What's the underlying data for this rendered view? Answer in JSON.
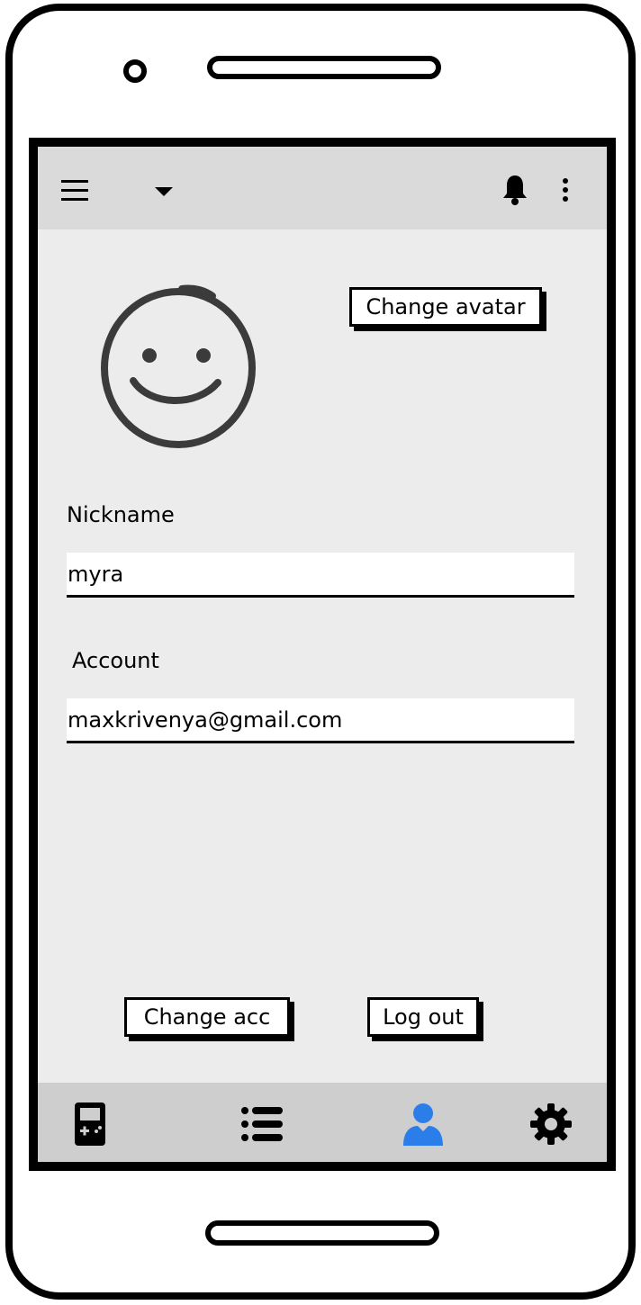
{
  "header": {
    "icons": [
      "menu-icon",
      "dropdown-caret-icon",
      "bell-icon",
      "more-vertical-icon"
    ]
  },
  "profile": {
    "change_avatar_label": "Change avatar",
    "nickname_label": "Nickname",
    "nickname_value": "myra",
    "account_label": "Account",
    "account_value": "maxkrivenya@gmail.com",
    "change_account_label": "Change acc",
    "logout_label": "Log out"
  },
  "bottom_nav": {
    "items": [
      {
        "icon": "gamepad-icon",
        "active": false
      },
      {
        "icon": "list-icon",
        "active": false
      },
      {
        "icon": "user-icon",
        "active": true
      },
      {
        "icon": "gear-icon",
        "active": false
      }
    ],
    "active_color": "#2b7de9",
    "inactive_color": "#000000"
  },
  "colors": {
    "screen_bg": "#ececec",
    "appbar_bg": "#dadada",
    "bottombar_bg": "#cecece"
  }
}
